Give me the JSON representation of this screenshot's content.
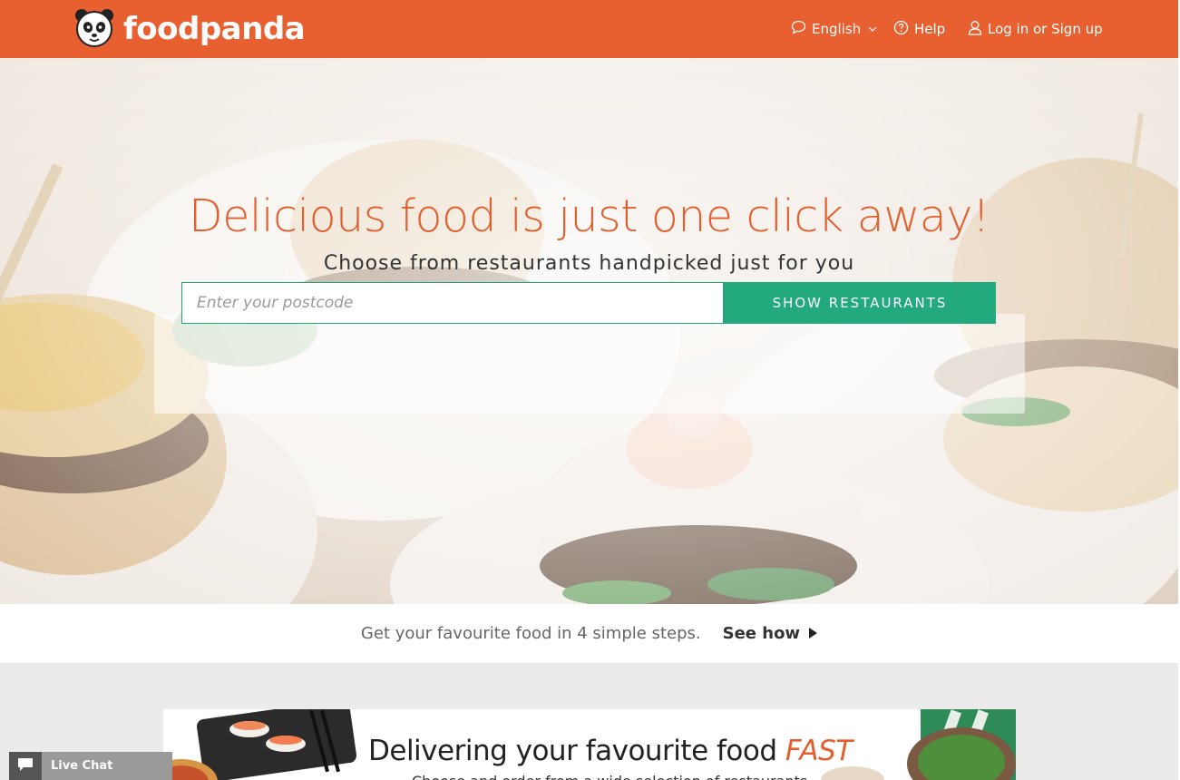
{
  "header": {
    "brand": "foodpanda",
    "nav": {
      "language": "English",
      "help": "Help",
      "login": "Log in or Sign up"
    }
  },
  "hero": {
    "title": "Delicious food is just one click away!",
    "subtitle": "Choose from restaurants handpicked just for you",
    "search": {
      "placeholder": "Enter your postcode",
      "value": "",
      "button_label": "SHOW RESTAURANTS"
    }
  },
  "steps": {
    "text": "Get your favourite food in 4 simple steps.",
    "link_label": "See how"
  },
  "banner": {
    "title_prefix": "Delivering your favourite food ",
    "title_accent": "FAST",
    "subtitle": "Choose and order from a wide selection of restaurants"
  },
  "live_chat": {
    "label": "Live Chat"
  },
  "colors": {
    "brand_orange": "#e8602f",
    "cta_green": "#22a97e",
    "title_orange": "#e35f2e"
  },
  "icons": {
    "logo": "panda-logo-icon",
    "language": "speech-bubble-icon",
    "help": "question-circle-icon",
    "login": "user-icon",
    "see_how": "play-triangle-icon",
    "live_chat": "chat-bubble-icon"
  }
}
